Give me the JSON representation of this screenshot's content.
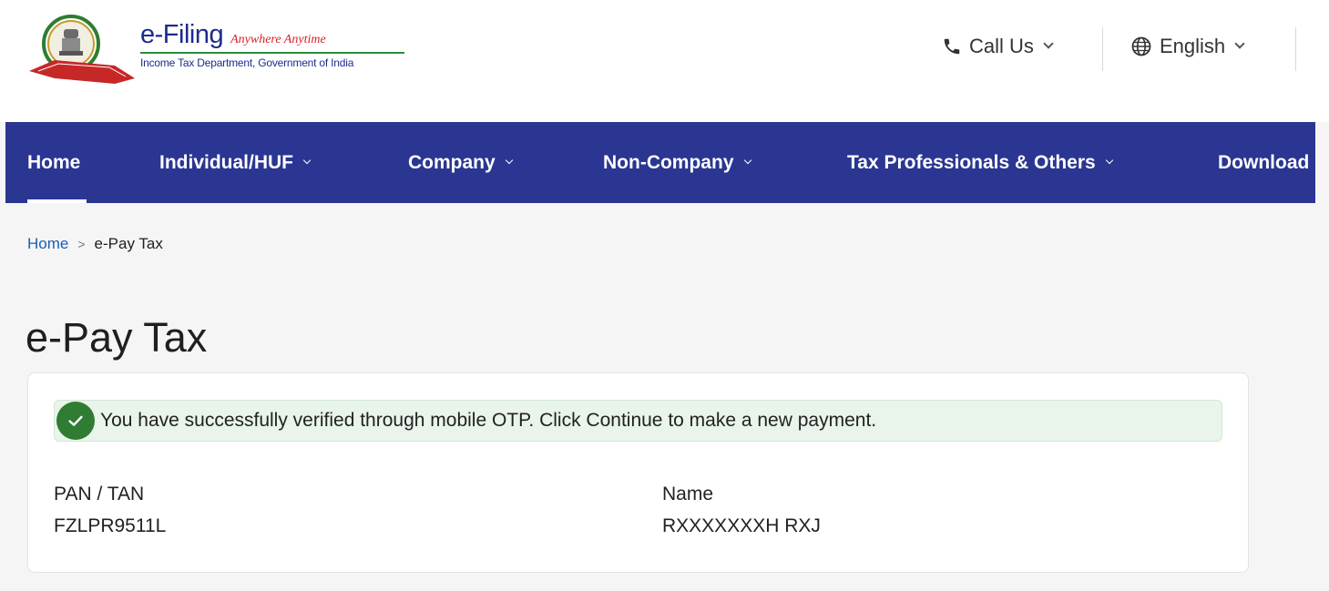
{
  "header": {
    "brand_name": "e-Filing",
    "brand_tagline": "Anywhere Anytime",
    "brand_subtitle": "Income Tax Department, Government of India",
    "call_us_label": "Call Us",
    "language_label": "English"
  },
  "nav": {
    "items": [
      {
        "label": "Home",
        "has_dropdown": false,
        "active": true
      },
      {
        "label": "Individual/HUF",
        "has_dropdown": true
      },
      {
        "label": "Company",
        "has_dropdown": true
      },
      {
        "label": "Non-Company",
        "has_dropdown": true
      },
      {
        "label": "Tax Professionals & Others",
        "has_dropdown": true
      },
      {
        "label": "Download",
        "has_dropdown": false
      }
    ]
  },
  "breadcrumb": {
    "home": "Home",
    "separator": ">",
    "current": "e-Pay Tax"
  },
  "page": {
    "title": "e-Pay Tax"
  },
  "alert": {
    "message": "You have successfully verified through mobile OTP. Click Continue to make a new payment."
  },
  "details": {
    "pan_label": "PAN / TAN",
    "pan_value": "FZLPR9511L",
    "name_label": "Name",
    "name_value": "RXXXXXXXH RXJ"
  },
  "colors": {
    "nav_bg": "#2a3692",
    "brand_blue": "#1c2c8c",
    "tagline_red": "#d8232a",
    "success_green": "#2e7d32",
    "alert_bg": "#e9f4ea",
    "link_blue": "#1a5fb4"
  }
}
